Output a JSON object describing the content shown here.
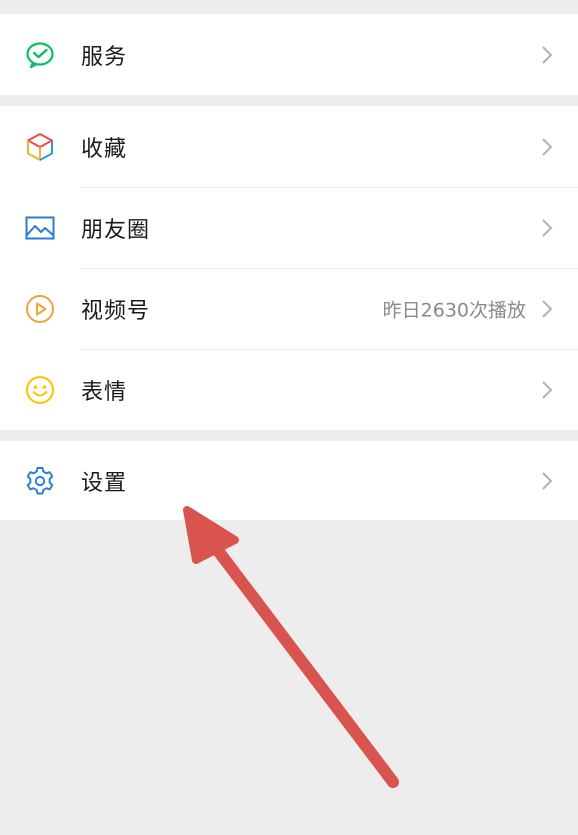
{
  "menu": {
    "services": {
      "label": "服务",
      "icon": "wechat-pay-icon"
    },
    "favorites": {
      "label": "收藏",
      "icon": "cube-icon"
    },
    "moments": {
      "label": "朋友圈",
      "icon": "image-icon"
    },
    "channels": {
      "label": "视频号",
      "icon": "play-circle-icon",
      "extra": "昨日2630次播放"
    },
    "stickers": {
      "label": "表情",
      "icon": "smiley-icon"
    },
    "settings": {
      "label": "设置",
      "icon": "gear-icon"
    }
  },
  "colors": {
    "background": "#ededed",
    "row": "#ffffff",
    "services": "#07c160",
    "moments": "#2b7bd8",
    "channels": "#f0a23b",
    "stickers": "#f7c400",
    "settings": "#2b7bd8",
    "annotation_arrow": "#d9534f"
  },
  "annotation": {
    "icon": "red-arrow-pointing-to-settings"
  }
}
